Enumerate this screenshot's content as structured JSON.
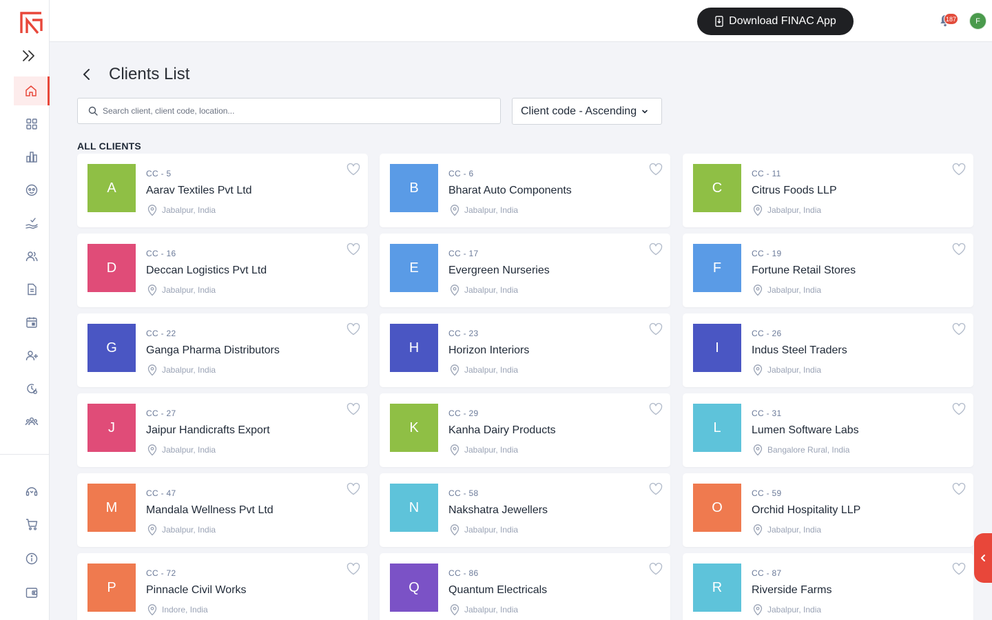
{
  "topbar": {
    "download_label": "Download FINAC App",
    "notification_count": "187",
    "avatar_initial": "F"
  },
  "sidebar": {
    "items": [
      {
        "icon": "home-icon"
      },
      {
        "icon": "grid-icon"
      },
      {
        "icon": "bar-chart-icon"
      },
      {
        "icon": "face-icon"
      },
      {
        "icon": "hand-check-icon"
      },
      {
        "icon": "users-icon"
      },
      {
        "icon": "document-icon"
      },
      {
        "icon": "calendar-icon"
      },
      {
        "icon": "user-plus-icon"
      },
      {
        "icon": "history-gear-icon"
      },
      {
        "icon": "team-icon"
      }
    ],
    "bottom_items": [
      {
        "icon": "support-icon"
      },
      {
        "icon": "cart-icon"
      },
      {
        "icon": "info-icon"
      },
      {
        "icon": "wallet-icon"
      }
    ],
    "accent_color": "#e8473a"
  },
  "page": {
    "title": "Clients List",
    "search_placeholder": "Search client, client code, location...",
    "sort_label": "Client code - Ascending",
    "section_title": "ALL CLIENTS"
  },
  "clients": [
    {
      "initial": "A",
      "code": "CC - 5",
      "name": "Aarav Textiles Pvt Ltd",
      "location": "Jabalpur, India",
      "color": "#8fbf45"
    },
    {
      "initial": "B",
      "code": "CC - 6",
      "name": "Bharat Auto Components",
      "location": "Jabalpur, India",
      "color": "#5a9be6"
    },
    {
      "initial": "C",
      "code": "CC - 11",
      "name": "Citrus Foods LLP",
      "location": "Jabalpur, India",
      "color": "#8fbf45"
    },
    {
      "initial": "D",
      "code": "CC - 16",
      "name": "Deccan Logistics Pvt Ltd",
      "location": "Jabalpur, India",
      "color": "#e04c78"
    },
    {
      "initial": "E",
      "code": "CC - 17",
      "name": "Evergreen Nurseries",
      "location": "Jabalpur, India",
      "color": "#5a9be6"
    },
    {
      "initial": "F",
      "code": "CC - 19",
      "name": "Fortune Retail Stores",
      "location": "Jabalpur, India",
      "color": "#5a9be6"
    },
    {
      "initial": "G",
      "code": "CC - 22",
      "name": "Ganga Pharma Distributors",
      "location": "Jabalpur, India",
      "color": "#4a56c3"
    },
    {
      "initial": "H",
      "code": "CC - 23",
      "name": "Horizon Interiors",
      "location": "Jabalpur, India",
      "color": "#4a56c3"
    },
    {
      "initial": "I",
      "code": "CC - 26",
      "name": "Indus Steel Traders",
      "location": "Jabalpur, India",
      "color": "#4a56c3"
    },
    {
      "initial": "J",
      "code": "CC - 27",
      "name": "Jaipur Handicrafts Export",
      "location": "Jabalpur, India",
      "color": "#e04c78"
    },
    {
      "initial": "K",
      "code": "CC - 29",
      "name": "Kanha Dairy Products",
      "location": "Jabalpur, India",
      "color": "#8fbf45"
    },
    {
      "initial": "L",
      "code": "CC - 31",
      "name": "Lumen Software Labs",
      "location": "Bangalore Rural, India",
      "color": "#5ec3da"
    },
    {
      "initial": "M",
      "code": "CC - 47",
      "name": "Mandala Wellness Pvt Ltd",
      "location": "Jabalpur, India",
      "color": "#ef7a4f"
    },
    {
      "initial": "N",
      "code": "CC - 58",
      "name": "Nakshatra Jewellers",
      "location": "Jabalpur, India",
      "color": "#5ec3da"
    },
    {
      "initial": "O",
      "code": "CC - 59",
      "name": "Orchid Hospitality LLP",
      "location": "Jabalpur, India",
      "color": "#ef7a4f"
    },
    {
      "initial": "P",
      "code": "CC - 72",
      "name": "Pinnacle Civil Works",
      "location": "Indore, India",
      "color": "#ef7a4f"
    },
    {
      "initial": "Q",
      "code": "CC - 86",
      "name": "Quantum Electricals",
      "location": "Jabalpur, India",
      "color": "#7b52c6"
    },
    {
      "initial": "R",
      "code": "CC - 87",
      "name": "Riverside Farms",
      "location": "Jabalpur, India",
      "color": "#5ec3da"
    }
  ]
}
